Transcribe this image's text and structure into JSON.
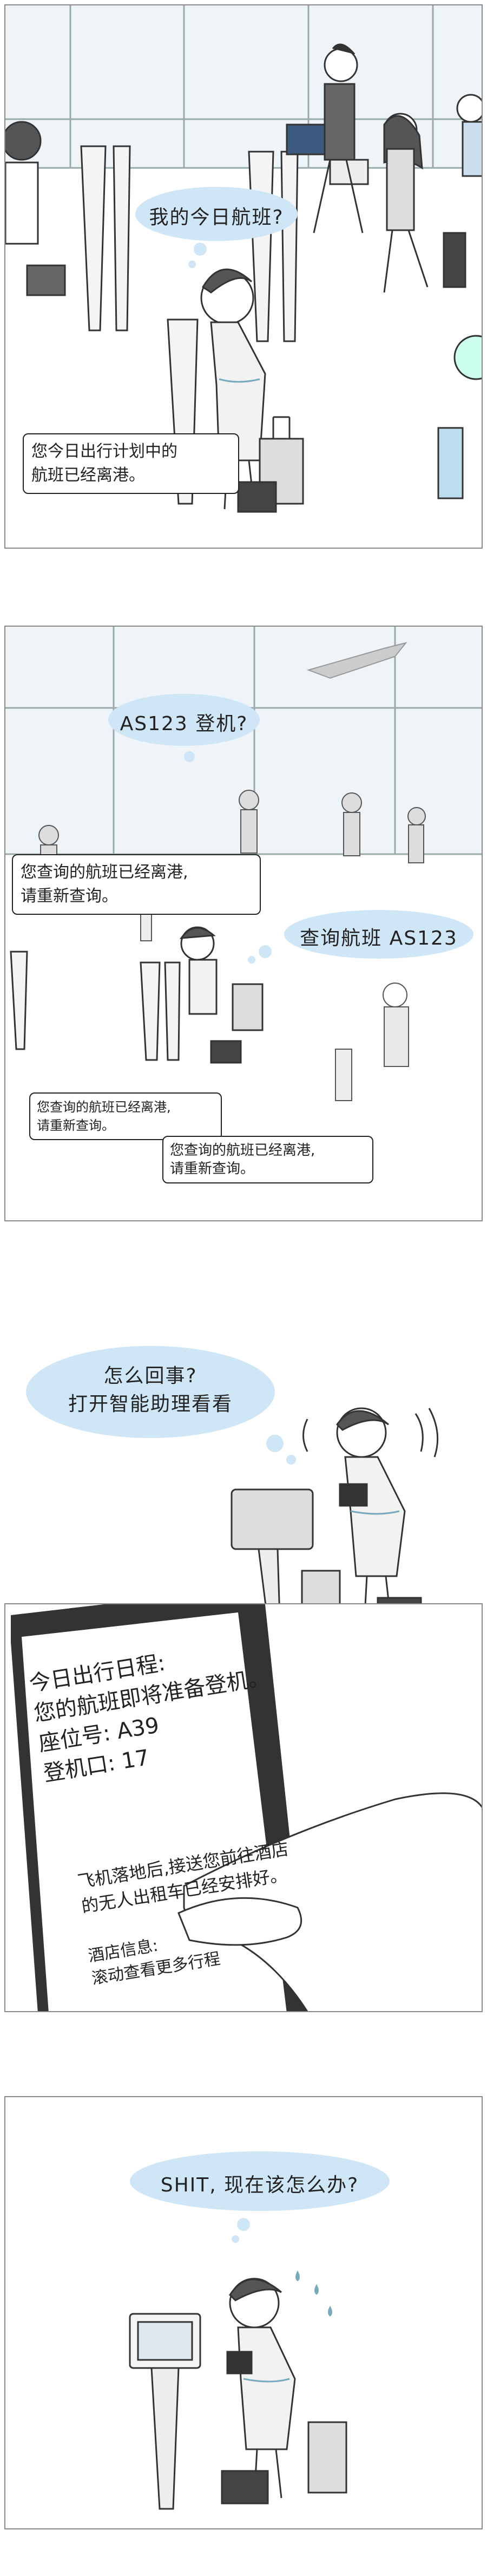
{
  "panel1": {
    "thought": "我的今日航班?",
    "notice": [
      "您今日出行计划中的",
      "航班已经离港。"
    ]
  },
  "panel2": {
    "thought": "AS123 登机?",
    "speech": "查询航班 AS123",
    "notice_top": [
      "您查询的航班已经离港,",
      "请重新查询。"
    ],
    "notice_mid": [
      "您查询的航班已经离港,",
      "请重新查询。"
    ],
    "notice_bottom": [
      "您查询的航班已经离港,",
      "请重新查询。"
    ]
  },
  "panel3": {
    "thought": [
      "怎么回事?",
      "打开智能助理看看"
    ]
  },
  "panel4": {
    "lines": [
      "今日出行日程:",
      "您的航班即将准备登机。",
      "座位号: A39",
      "登机口: 17"
    ],
    "lines2": [
      "飞机落地后,接送您前往酒店",
      "的无人出租车已经安排好。"
    ],
    "lines3": [
      "酒店信息:",
      "滚动查看更多行程"
    ]
  },
  "panel5": {
    "thought": "SHIT, 现在该怎么办?"
  },
  "colors": {
    "cloud": "#cfe6f7",
    "border": "#8a8a8a",
    "ink": "#222222"
  }
}
